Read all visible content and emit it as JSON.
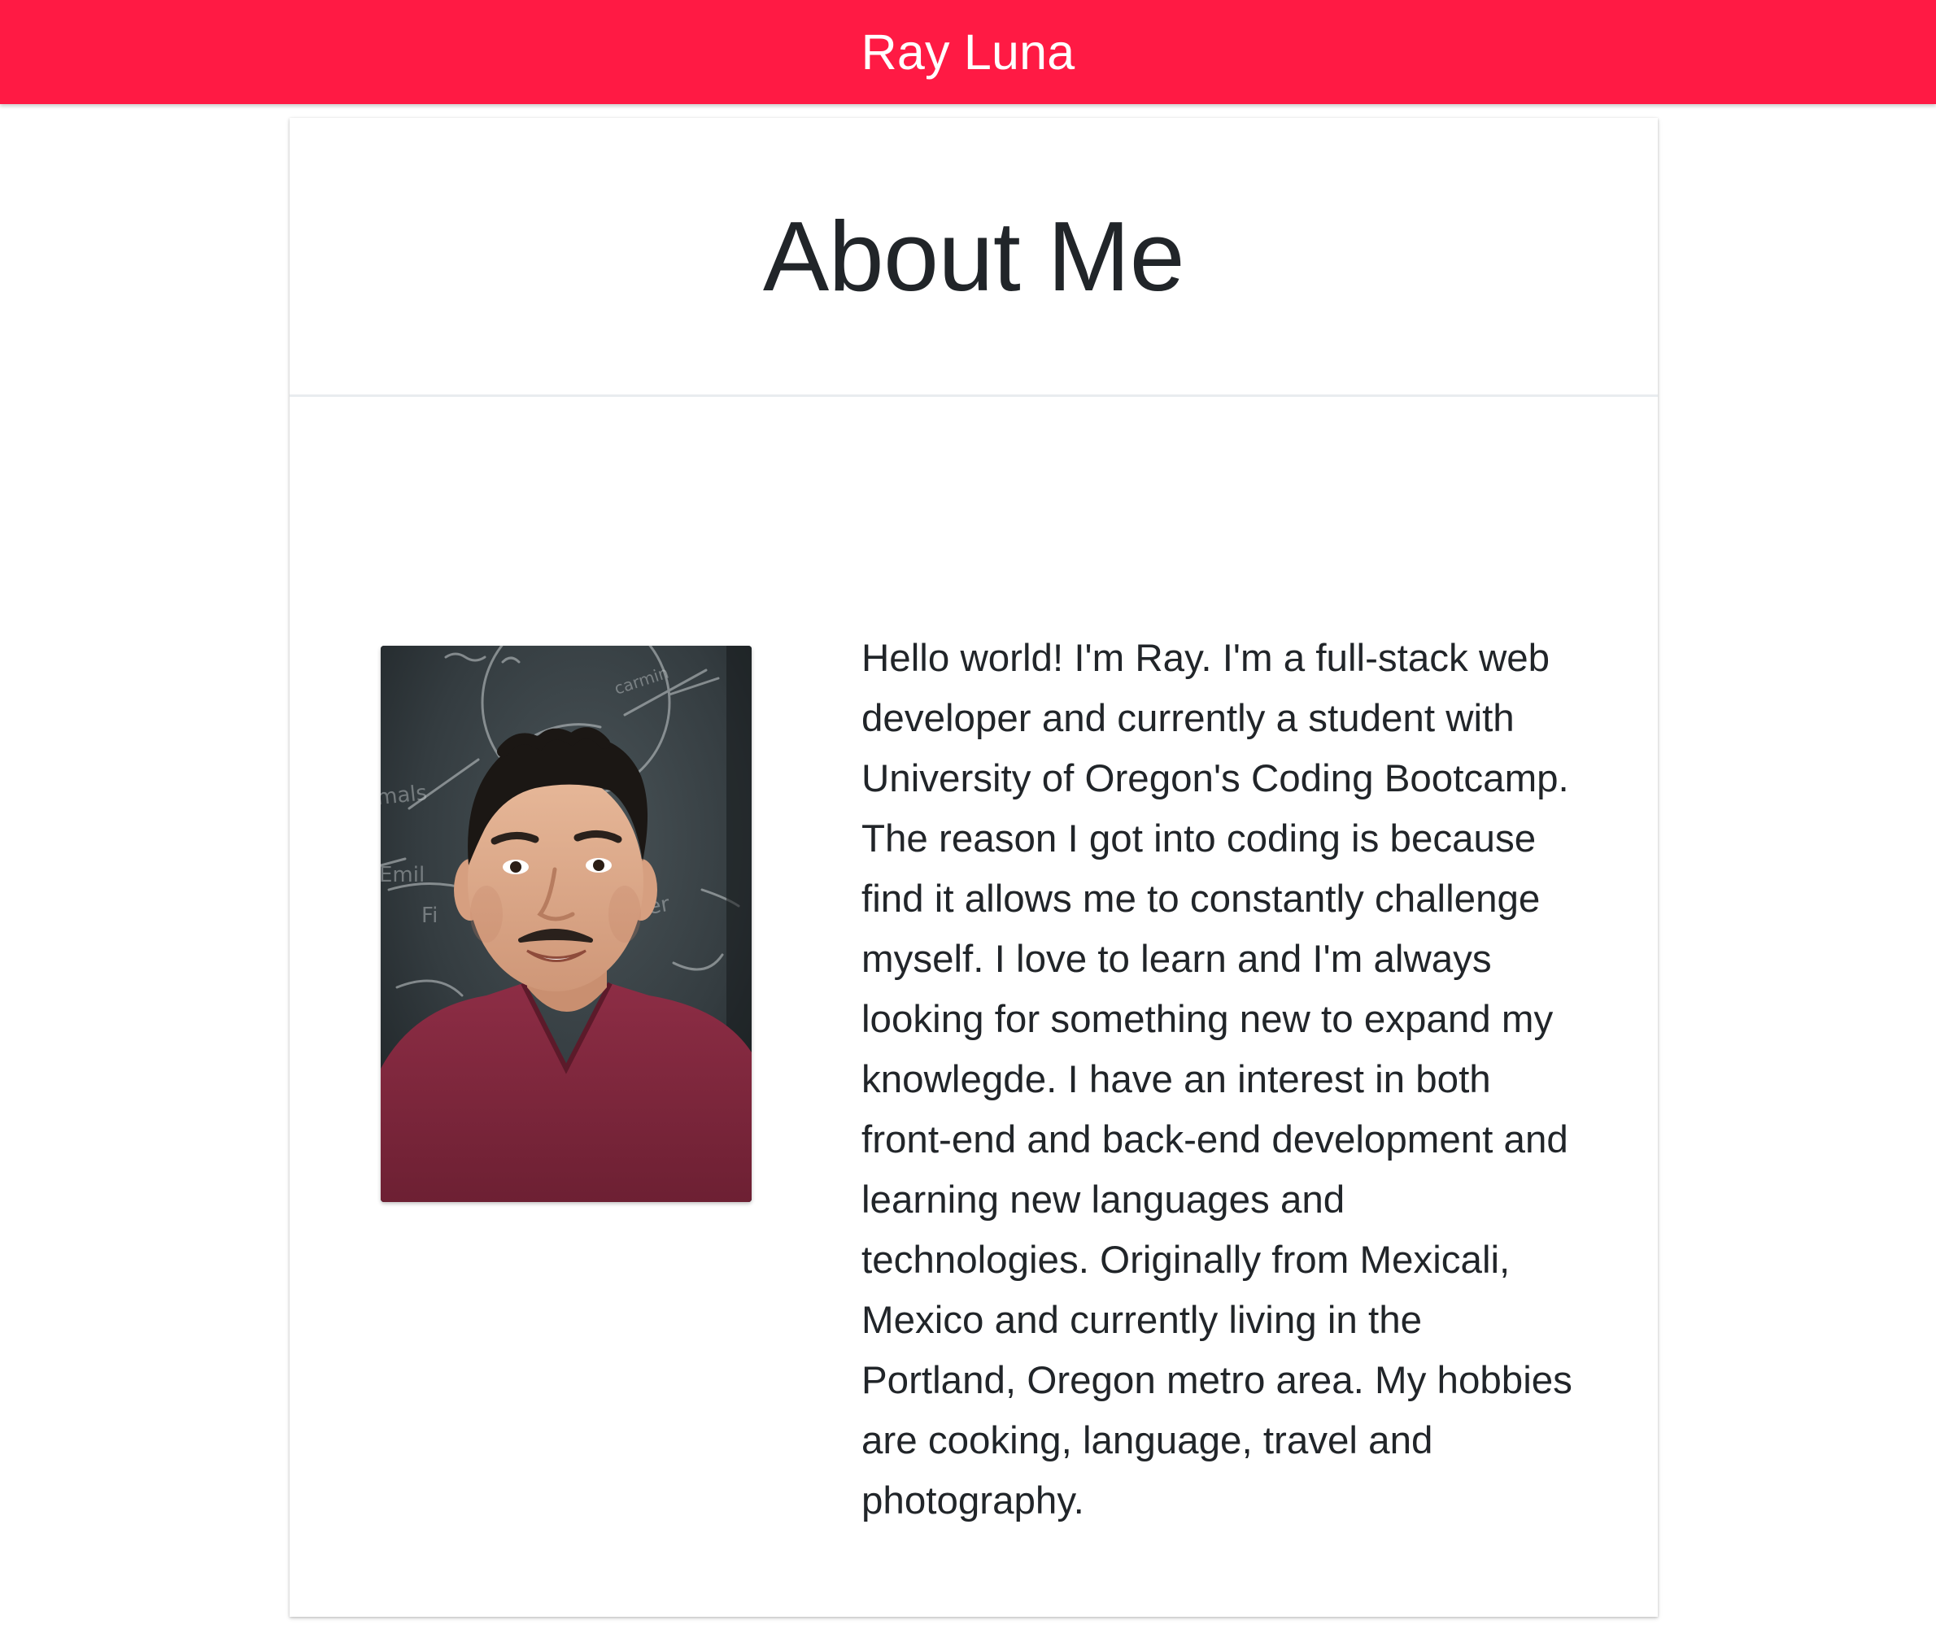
{
  "navbar": {
    "brand": "Ray Luna",
    "accent_color": "#ff1a44"
  },
  "about": {
    "title": "About Me",
    "photo_description": "profile-photo",
    "bio": "Hello world! I'm Ray. I'm a full-stack web developer and currently a student with University of Oregon's Coding Bootcamp. The reason I got into coding is because find it allows me to constantly challenge myself. I love to learn and I'm always looking for something new to expand my knowlegde. I have an interest in both front-end and back-end development and learning new languages and technologies. Originally from Mexicali, Mexico and currently living in the Portland, Oregon metro area. My hobbies are cooking, language, travel and photography."
  }
}
